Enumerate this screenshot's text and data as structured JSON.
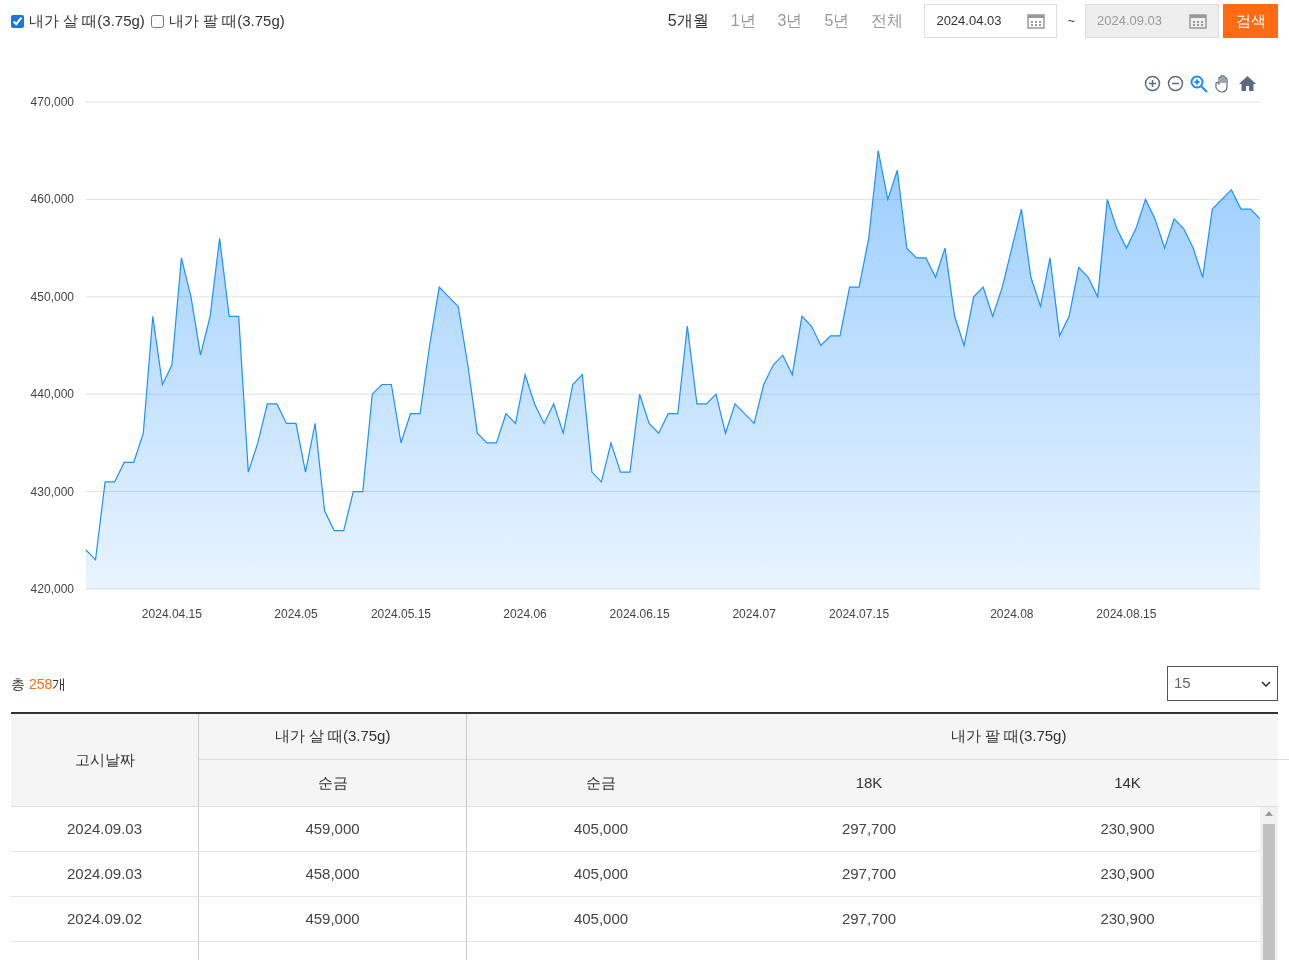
{
  "filters": [
    {
      "label": "내가 살 때(3.75g)",
      "checked": true
    },
    {
      "label": "내가 팔 때(3.75g)",
      "checked": false
    }
  ],
  "periods": [
    {
      "label": "5개월",
      "selected": true
    },
    {
      "label": "1년",
      "selected": false
    },
    {
      "label": "3년",
      "selected": false
    },
    {
      "label": "5년",
      "selected": false
    },
    {
      "label": "전체",
      "selected": false
    }
  ],
  "date_from": {
    "value": "2024.04.03",
    "disabled": false
  },
  "range_separator": "~",
  "date_to": {
    "value": "2024.09.03",
    "disabled": true
  },
  "search_button": "검색",
  "chart": {
    "chart_data": {
      "type": "area",
      "grid": true,
      "ylim": [
        420000,
        470000
      ],
      "yticks": [
        {
          "value": 420000,
          "label": "420,000"
        },
        {
          "value": 430000,
          "label": "430,000"
        },
        {
          "value": 440000,
          "label": "440,000"
        },
        {
          "value": 450000,
          "label": "450,000"
        },
        {
          "value": 460000,
          "label": "460,000"
        },
        {
          "value": 470000,
          "label": "470,000"
        }
      ],
      "categories": [
        null,
        null,
        null,
        null,
        null,
        null,
        null,
        null,
        null,
        "2024.04.15",
        null,
        null,
        null,
        null,
        null,
        null,
        null,
        null,
        null,
        null,
        null,
        null,
        "2024.05",
        null,
        null,
        null,
        null,
        null,
        null,
        null,
        null,
        null,
        null,
        "2024.05.15",
        null,
        null,
        null,
        null,
        null,
        null,
        null,
        null,
        null,
        null,
        null,
        null,
        "2024.06",
        null,
        null,
        null,
        null,
        null,
        null,
        null,
        null,
        null,
        null,
        null,
        "2024.06.15",
        null,
        null,
        null,
        null,
        null,
        null,
        null,
        null,
        null,
        null,
        null,
        "2024.07",
        null,
        null,
        null,
        null,
        null,
        null,
        null,
        null,
        null,
        null,
        "2024.07.15",
        null,
        null,
        null,
        null,
        null,
        null,
        null,
        null,
        null,
        null,
        null,
        null,
        null,
        null,
        null,
        "2024.08",
        null,
        null,
        null,
        null,
        null,
        null,
        null,
        null,
        null,
        null,
        null,
        "2024.08.15",
        null,
        null,
        null,
        null,
        null,
        null,
        null,
        null,
        null,
        null,
        null,
        null,
        null,
        null
      ],
      "series": [
        {
          "color": "#1e90ff",
          "values": [
            424000,
            423000,
            431000,
            431000,
            433000,
            433000,
            436000,
            448000,
            441000,
            443000,
            454000,
            450000,
            444000,
            448000,
            456000,
            448000,
            448000,
            432000,
            435000,
            439000,
            439000,
            437000,
            437000,
            432000,
            437000,
            428000,
            426000,
            426000,
            430000,
            430000,
            440000,
            441000,
            441000,
            435000,
            438000,
            438000,
            445000,
            451000,
            450000,
            449000,
            443000,
            436000,
            435000,
            435000,
            438000,
            437000,
            442000,
            439000,
            437000,
            439000,
            436000,
            441000,
            442000,
            432000,
            431000,
            435000,
            432000,
            432000,
            440000,
            437000,
            436000,
            438000,
            438000,
            447000,
            439000,
            439000,
            440000,
            436000,
            439000,
            438000,
            437000,
            441000,
            443000,
            444000,
            442000,
            448000,
            447000,
            445000,
            446000,
            446000,
            451000,
            451000,
            456000,
            465000,
            460000,
            463000,
            455000,
            454000,
            454000,
            452000,
            455000,
            448000,
            445000,
            450000,
            451000,
            448000,
            451000,
            455000,
            459000,
            452000,
            449000,
            454000,
            446000,
            448000,
            453000,
            452000,
            450000,
            460000,
            457000,
            455000,
            457000,
            460000,
            458000,
            455000,
            458000,
            457000,
            455000,
            452000,
            459000,
            460000,
            461000,
            459000,
            459000,
            458000
          ]
        }
      ]
    }
  },
  "total": {
    "prefix": "총 ",
    "count": "258",
    "suffix": "개"
  },
  "page_size": "15",
  "table": {
    "group_headers": [
      "고시날짜",
      "내가 살 때(3.75g)",
      "내가 팔 때(3.75g)"
    ],
    "columns": [
      "",
      "순금",
      "순금",
      "18K",
      "14K"
    ],
    "rows": [
      [
        "2024.09.03",
        "459,000",
        "405,000",
        "297,700",
        "230,900"
      ],
      [
        "2024.09.03",
        "458,000",
        "405,000",
        "297,700",
        "230,900"
      ],
      [
        "2024.09.02",
        "459,000",
        "405,000",
        "297,700",
        "230,900"
      ]
    ]
  }
}
